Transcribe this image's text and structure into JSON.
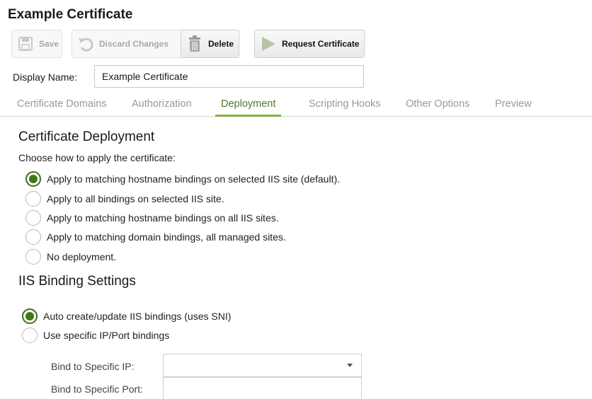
{
  "title": "Example Certificate",
  "toolbar": {
    "save": "Save",
    "discard": "Discard Changes",
    "delete": "Delete",
    "request": "Request Certificate"
  },
  "display_name": {
    "label": "Display Name:",
    "value": "Example Certificate"
  },
  "tabs": [
    {
      "label": "Certificate Domains",
      "active": false
    },
    {
      "label": "Authorization",
      "active": false
    },
    {
      "label": "Deployment",
      "active": true
    },
    {
      "label": "Scripting Hooks",
      "active": false
    },
    {
      "label": "Other Options",
      "active": false
    },
    {
      "label": "Preview",
      "active": false
    }
  ],
  "deployment": {
    "heading": "Certificate Deployment",
    "prompt": "Choose how to apply the certificate:",
    "options": [
      {
        "label": "Apply to matching hostname bindings on selected IIS site (default).",
        "selected": true
      },
      {
        "label": "Apply to all bindings on selected IIS site.",
        "selected": false
      },
      {
        "label": "Apply to matching hostname bindings on all IIS sites.",
        "selected": false
      },
      {
        "label": "Apply to matching domain bindings, all managed sites.",
        "selected": false
      },
      {
        "label": "No deployment.",
        "selected": false
      }
    ]
  },
  "binding": {
    "heading": "IIS Binding Settings",
    "options": [
      {
        "label": "Auto create/update IIS bindings (uses SNI)",
        "selected": true
      },
      {
        "label": "Use specific IP/Port bindings",
        "selected": false
      }
    ],
    "ip_label": "Bind to Specific IP:",
    "ip_value": "",
    "port_label": "Bind to Specific Port:",
    "port_value": ""
  },
  "colors": {
    "accent": "#7fb13f",
    "radio_selected": "#3f7a15",
    "tab_active_text": "#4d7a2a",
    "tab_inactive_text": "#9a9a9a"
  }
}
